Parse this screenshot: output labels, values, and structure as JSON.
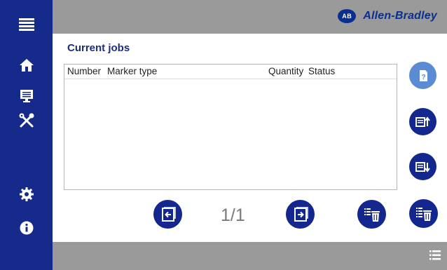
{
  "header": {
    "brand_logo_text": "AB",
    "brand_name": "Allen-Bradley"
  },
  "page": {
    "title": "Current jobs"
  },
  "table": {
    "columns": [
      "Number",
      "Marker type",
      "Quantity",
      "Status"
    ],
    "rows": []
  },
  "pagination": {
    "indicator": "1/1"
  },
  "sidebar": {
    "items": [
      {
        "icon": "menu-icon"
      },
      {
        "icon": "home-icon"
      },
      {
        "icon": "monitor-icon"
      },
      {
        "icon": "tools-icon"
      },
      {
        "icon": "gear-icon"
      },
      {
        "icon": "info-icon"
      }
    ]
  },
  "colors": {
    "sidebar": "#152a8a",
    "bars": "#9a9a9a",
    "accent": "#14278e",
    "accent_light": "#5b8bd2",
    "title": "#1a2e7a"
  }
}
